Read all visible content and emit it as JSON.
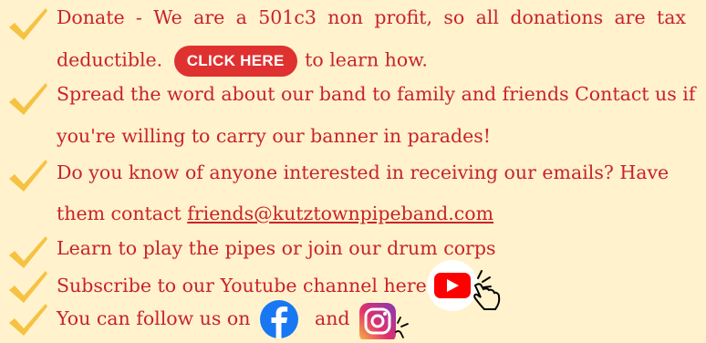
{
  "colors": {
    "background": "#fff2cc",
    "text": "#c8232c",
    "check": "#f5c242",
    "cta_bg": "#e03131",
    "youtube": "#ff0000",
    "facebook": "#1877f2"
  },
  "items": [
    {
      "icon": "checkmark-icon",
      "line1_prefix": "Donate - We are a 501c3 non profit, so all donations are tax",
      "line2_prefix": "deductible.",
      "cta_label": "CLICK HERE",
      "line2_suffix": "to learn how."
    },
    {
      "icon": "checkmark-icon",
      "line1": "Spread the word about our band to family and friends Contact us if",
      "line2": "you're willing to carry our banner in parades!"
    },
    {
      "icon": "checkmark-icon",
      "line1": "Do you know of anyone interested in receiving our emails? Have",
      "line2_prefix": "them contact ",
      "email": "friends@kutztownpipeband.com"
    },
    {
      "icon": "checkmark-icon",
      "line1": "Learn to play the pipes or join our drum corps"
    },
    {
      "icon": "checkmark-icon",
      "line1": "Subscribe to our Youtube channel here",
      "link_icon": "youtube-icon"
    },
    {
      "icon": "checkmark-icon",
      "line1_prefix": "You can follow us on",
      "line1_mid": "and",
      "link_icons": [
        "facebook-icon",
        "instagram-icon"
      ]
    }
  ]
}
